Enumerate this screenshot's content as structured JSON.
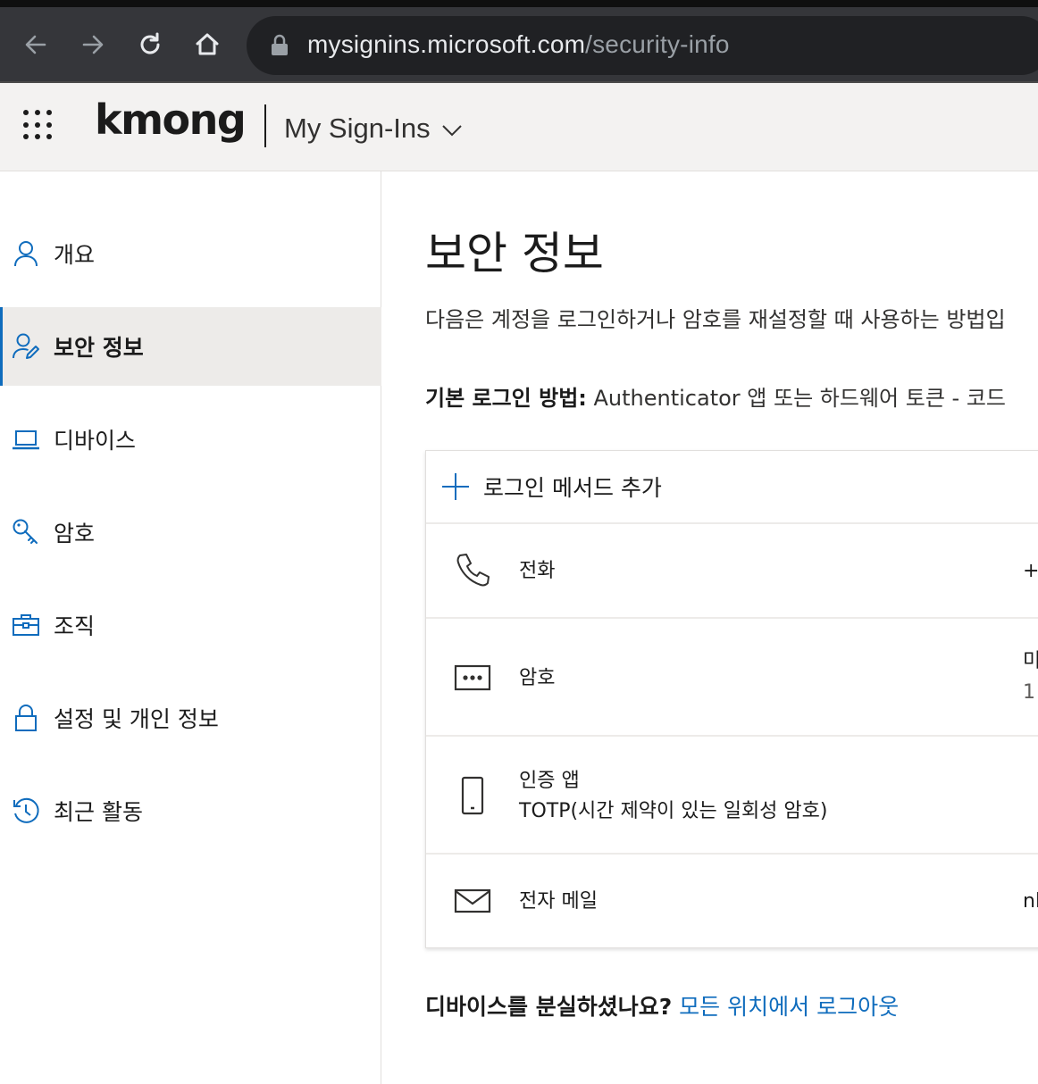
{
  "browser": {
    "url_host": "mysignins.microsoft.com",
    "url_path": "/security-info",
    "icons": [
      "back-icon",
      "forward-icon",
      "reload-icon",
      "home-icon",
      "lock-icon"
    ]
  },
  "header": {
    "brand": "kmong",
    "product": "My Sign-Ins"
  },
  "sidebar": {
    "items": [
      {
        "label": "개요",
        "icon": "person-icon"
      },
      {
        "label": "보안 정보",
        "icon": "person-edit-icon",
        "active": true
      },
      {
        "label": "디바이스",
        "icon": "laptop-icon"
      },
      {
        "label": "암호",
        "icon": "key-icon"
      },
      {
        "label": "조직",
        "icon": "briefcase-icon"
      },
      {
        "label": "설정 및 개인 정보",
        "icon": "lock-icon"
      },
      {
        "label": "최근 활동",
        "icon": "history-icon"
      }
    ]
  },
  "main": {
    "title": "보안 정보",
    "description": "다음은 계정을 로그인하거나 암호를 재설정할 때 사용하는 방법입",
    "default_method_label": "기본 로그인 방법:",
    "default_method_value": " Authenticator 앱 또는 하드웨어 토큰 - 코드",
    "add_method": "로그인 메서드 추가",
    "methods": [
      {
        "label": "전화",
        "detail": "+",
        "icon": "phone-icon"
      },
      {
        "label": "암호",
        "detail_line1": "미",
        "detail_line2": "1",
        "icon": "password-dots-icon"
      },
      {
        "label_line1": "인증 앱",
        "label_line2": "TOTP(시간 제약이 있는 일회성 암호)",
        "icon": "mobile-device-icon"
      },
      {
        "label": "전자 메일",
        "detail": "nl",
        "icon": "mail-icon"
      }
    ],
    "lost_device_question": "디바이스를 분실하셨나요?",
    "lost_device_link": "모든 위치에서 로그아웃"
  },
  "colors": {
    "accent": "#0f6cbd",
    "chrome_bg": "#35363a",
    "header_bg": "#f3f2f1",
    "active_item_bg": "#edebe9"
  }
}
